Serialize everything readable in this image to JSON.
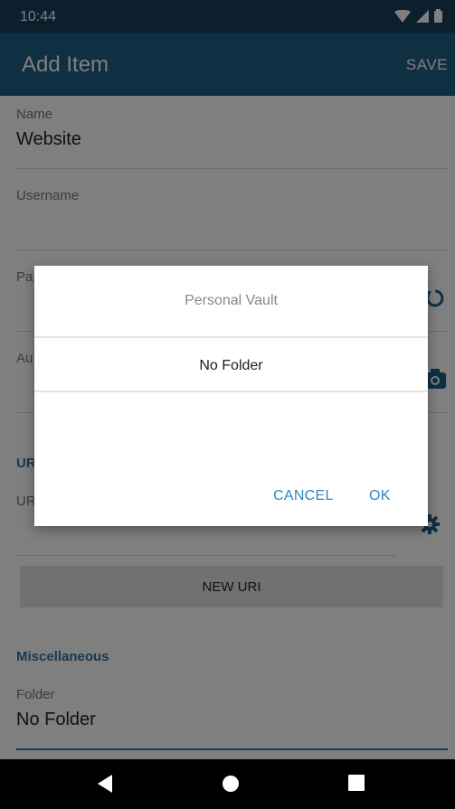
{
  "status_bar": {
    "time": "10:44",
    "icons": [
      "wifi-icon",
      "cell-signal-icon",
      "battery-icon"
    ]
  },
  "app_bar": {
    "title": "Add Item",
    "save_label": "SAVE"
  },
  "form": {
    "name": {
      "label": "Name",
      "value": "Website"
    },
    "username": {
      "label": "Username",
      "value": ""
    },
    "password": {
      "label_partial": "Pa"
    },
    "authenticator": {
      "label_partial": "Au"
    },
    "uris_section_partial": "UR",
    "uri_field_partial": "UR",
    "new_uri_label": "NEW URI",
    "misc_section": "Miscellaneous",
    "folder": {
      "label": "Folder",
      "value": "No Folder"
    }
  },
  "dialog": {
    "title": "Personal Vault",
    "options": [
      "No Folder"
    ],
    "cancel_label": "CANCEL",
    "ok_label": "OK"
  },
  "nav_bar": {
    "icons": [
      "back-icon",
      "home-icon",
      "recents-icon"
    ]
  },
  "colors": {
    "primary": "#1e5e87",
    "status": "#173f5a",
    "accent": "#2f74a5",
    "button": "#2f86c0"
  }
}
